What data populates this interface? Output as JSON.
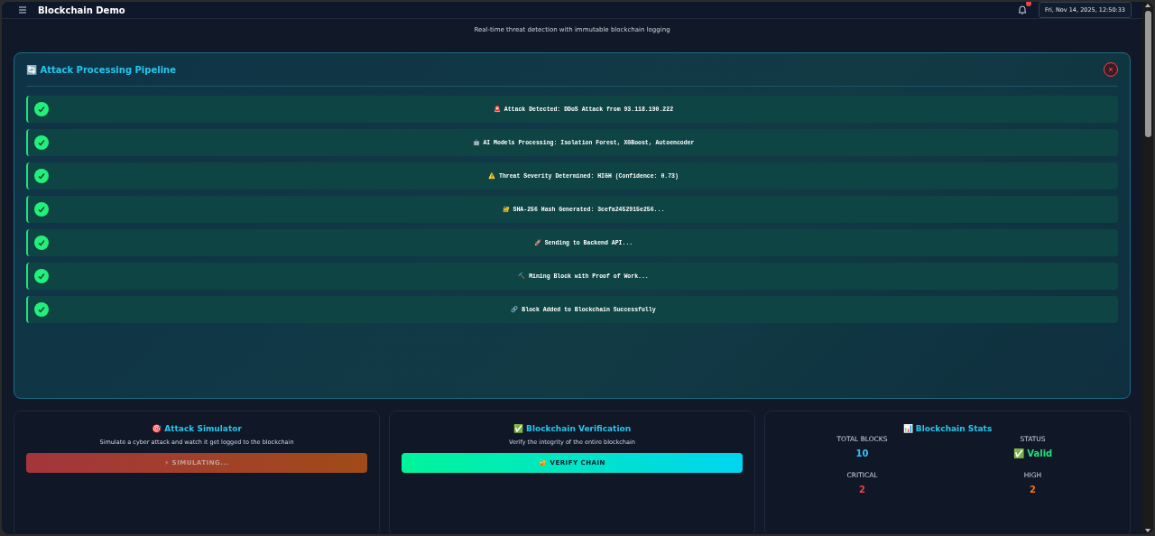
{
  "header": {
    "title": "Blockchain Demo",
    "notifications": {
      "unread": true
    },
    "datetime": "Fri, Nov 14, 2025, 12:50:33"
  },
  "subtitle": "Real-time threat detection with immutable blockchain logging",
  "pipeline": {
    "icon": "🔄",
    "title": "Attack Processing Pipeline",
    "steps": [
      {
        "text": "🚨 Attack Detected: DDoS Attack from 93.118.190.222",
        "done": true
      },
      {
        "text": "🤖 AI Models Processing: Isolation Forest, XGBoost, Autoencoder",
        "done": true
      },
      {
        "text": "⚠️ Threat Severity Determined: HIGH (Confidence: 0.73)",
        "done": true
      },
      {
        "text": "🔐 SHA-256 Hash Generated: 3cefa2452915e256...",
        "done": true
      },
      {
        "text": "🚀 Sending to Backend API...",
        "done": true
      },
      {
        "text": "⛏️ Mining Block with Proof of Work...",
        "done": true
      },
      {
        "text": "🔗 Block Added to Blockchain Successfully",
        "done": true
      }
    ]
  },
  "cards": [
    {
      "kind": "simulator",
      "icon": "🎯",
      "title": "Attack Simulator",
      "description": "Simulate a cyber attack and watch it get logged to the blockchain",
      "button": {
        "label": "⚡ SIMULATING...",
        "disabled": true
      }
    },
    {
      "kind": "verification",
      "icon": "✅",
      "title": "Blockchain Verification",
      "description": "Verify the integrity of the entire blockchain",
      "button": {
        "label": "🔐 VERIFY CHAIN",
        "disabled": false
      }
    },
    {
      "kind": "stats",
      "icon": "📊",
      "title": "Blockchain Stats",
      "stats": [
        {
          "label": "TOTAL BLOCKS",
          "value": "10",
          "color": "#38bdf8"
        },
        {
          "label": "STATUS",
          "value": "✅ Valid",
          "color": "#22e07a"
        },
        {
          "label": "CRITICAL",
          "value": "2",
          "color": "#ef4444"
        },
        {
          "label": "HIGH",
          "value": "2",
          "color": "#f97316"
        }
      ]
    }
  ]
}
